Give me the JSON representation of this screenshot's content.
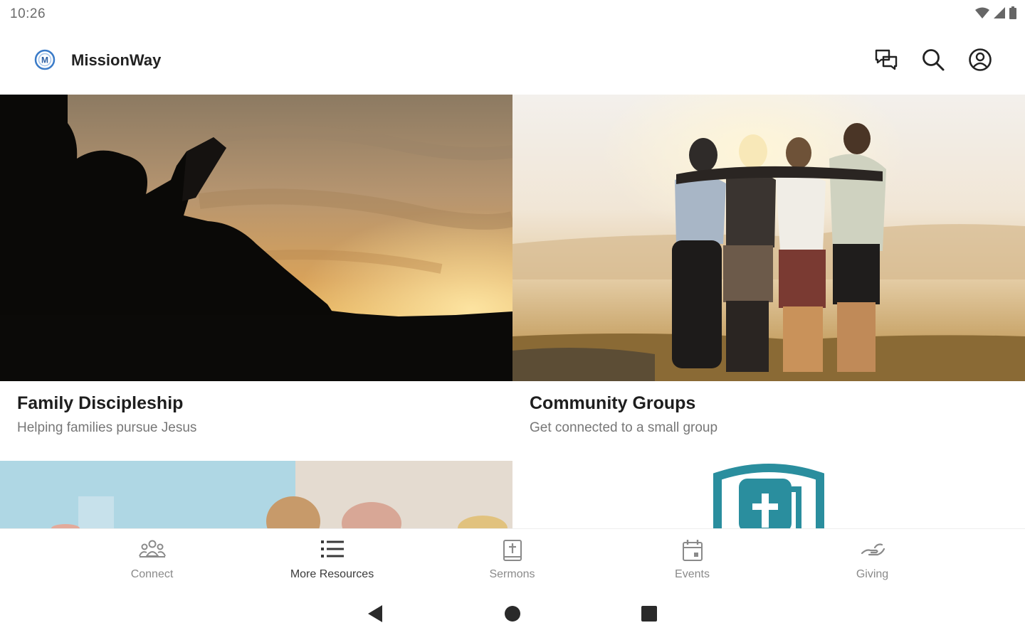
{
  "status_bar": {
    "time": "10:26"
  },
  "app_bar": {
    "title": "MissionWay",
    "logo_letter": "M",
    "actions": [
      "chat-icon",
      "search-icon",
      "account-icon"
    ]
  },
  "cards": [
    {
      "title": "Family Discipleship",
      "subtitle": "Helping families pursue Jesus",
      "image": "silhouette-reading-sunset"
    },
    {
      "title": "Community Groups",
      "subtitle": "Get connected to a small group",
      "image": "friends-hugging-sunset"
    },
    {
      "title": "",
      "subtitle": "",
      "image": "family-group-photo"
    },
    {
      "title": "",
      "subtitle": "",
      "image": "church-bible-logo"
    }
  ],
  "bottom_nav": {
    "items": [
      {
        "label": "Connect",
        "icon": "people-icon"
      },
      {
        "label": "More Resources",
        "icon": "list-icon"
      },
      {
        "label": "Sermons",
        "icon": "bible-icon"
      },
      {
        "label": "Events",
        "icon": "calendar-icon"
      },
      {
        "label": "Giving",
        "icon": "giving-hand-icon"
      }
    ],
    "active_index": 1
  },
  "system_nav": [
    "back-icon",
    "home-icon",
    "recents-icon"
  ],
  "colors": {
    "accent": "#2a8e9e",
    "logo_ring": "#3a7bc8"
  }
}
